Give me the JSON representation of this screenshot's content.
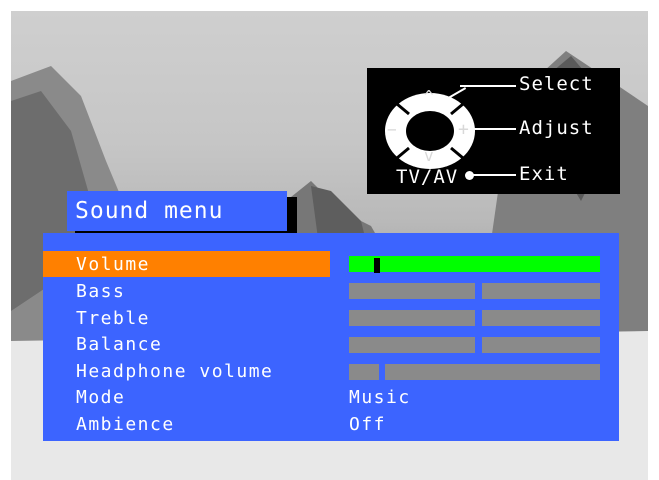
{
  "help": {
    "select_label": "Select",
    "adjust_label": "Adjust",
    "exit_label": "Exit",
    "tvav_label": "TV/AV",
    "up_symbol": "^",
    "down_symbol": "v",
    "minus_symbol": "−",
    "plus_symbol": "+"
  },
  "menu": {
    "title": "Sound menu",
    "items": [
      {
        "label": "Volume",
        "selected": true,
        "level": 0.1
      },
      {
        "label": "Bass"
      },
      {
        "label": "Treble"
      },
      {
        "label": "Balance"
      },
      {
        "label": "Headphone volume"
      },
      {
        "label": "Mode",
        "value": "Music"
      },
      {
        "label": "Ambience",
        "value": "Off"
      }
    ]
  },
  "colors": {
    "menu_bg": "#3c64ff",
    "selected": "#ff8000",
    "level_fill": "#00ff00",
    "inactive_bar": "#8a8a8a"
  }
}
